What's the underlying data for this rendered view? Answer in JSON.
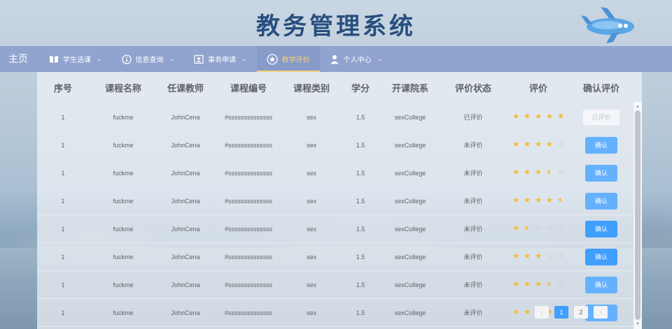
{
  "header": {
    "title": "教务管理系统"
  },
  "nav": {
    "home": "主页",
    "items": [
      {
        "label": "学生选课",
        "icon": "book-icon",
        "dropdown": true
      },
      {
        "label": "信息查询",
        "icon": "info-icon",
        "dropdown": true
      },
      {
        "label": "事务申请",
        "icon": "id-card-icon",
        "dropdown": true
      },
      {
        "label": "教学评价",
        "icon": "medal-icon",
        "dropdown": false,
        "active": true
      },
      {
        "label": "个人中心",
        "icon": "user-icon",
        "dropdown": true
      }
    ],
    "active_color": "#f3d27a"
  },
  "table": {
    "columns": [
      "序号",
      "课程名称",
      "任课教师",
      "课程编号",
      "课程类别",
      "学分",
      "开课院系",
      "评价状态",
      "评价",
      "确认评价"
    ],
    "rows": [
      {
        "index": "1",
        "course": "fuckme",
        "teacher": "JohnCena",
        "code": "#ssssssssssssss",
        "category": "sex",
        "credit": "1.5",
        "college": "sexCollege",
        "status": "已评价",
        "rating": 5,
        "action": "已评价",
        "action_state": "disabled"
      },
      {
        "index": "1",
        "course": "fuckme",
        "teacher": "JohnCena",
        "code": "#ssssssssssssss",
        "category": "sex",
        "credit": "1.5",
        "college": "sexCollege",
        "status": "未评价",
        "rating": 4,
        "action": "确认",
        "action_state": "normal"
      },
      {
        "index": "1",
        "course": "fuckme",
        "teacher": "JohnCena",
        "code": "#ssssssssssssss",
        "category": "sex",
        "credit": "1.5",
        "college": "sexCollege",
        "status": "未评价",
        "rating": 3.5,
        "action": "确认",
        "action_state": "normal"
      },
      {
        "index": "1",
        "course": "fuckme",
        "teacher": "JohnCena",
        "code": "#ssssssssssssss",
        "category": "sex",
        "credit": "1.5",
        "college": "sexCollege",
        "status": "未评价",
        "rating": 4.5,
        "action": "确认",
        "action_state": "normal"
      },
      {
        "index": "1",
        "course": "fuckme",
        "teacher": "JohnCena",
        "code": "#ssssssssssssss",
        "category": "sex",
        "credit": "1.5",
        "college": "sexCollege",
        "status": "未评价",
        "rating": 1.5,
        "action": "确认",
        "action_state": "dark"
      },
      {
        "index": "1",
        "course": "fuckme",
        "teacher": "JohnCena",
        "code": "#ssssssssssssss",
        "category": "sex",
        "credit": "1.5",
        "college": "sexCollege",
        "status": "未评价",
        "rating": 3,
        "action": "确认",
        "action_state": "dark"
      },
      {
        "index": "1",
        "course": "fuckme",
        "teacher": "JohnCena",
        "code": "#ssssssssssssss",
        "category": "sex",
        "credit": "1.5",
        "college": "sexCollege",
        "status": "未评价",
        "rating": 3.5,
        "action": "确认",
        "action_state": "normal"
      },
      {
        "index": "1",
        "course": "fuckme",
        "teacher": "JohnCena",
        "code": "#ssssssssssssss",
        "category": "sex",
        "credit": "1.5",
        "college": "sexCollege",
        "status": "未评价",
        "rating": 5,
        "action": "确认",
        "action_state": "normal"
      }
    ],
    "star_color": "#f7ba2a",
    "button_color": "#66b1ff"
  },
  "pagination": {
    "prev": "‹",
    "pages": [
      "1",
      "2"
    ],
    "current": "1",
    "next": "›"
  }
}
